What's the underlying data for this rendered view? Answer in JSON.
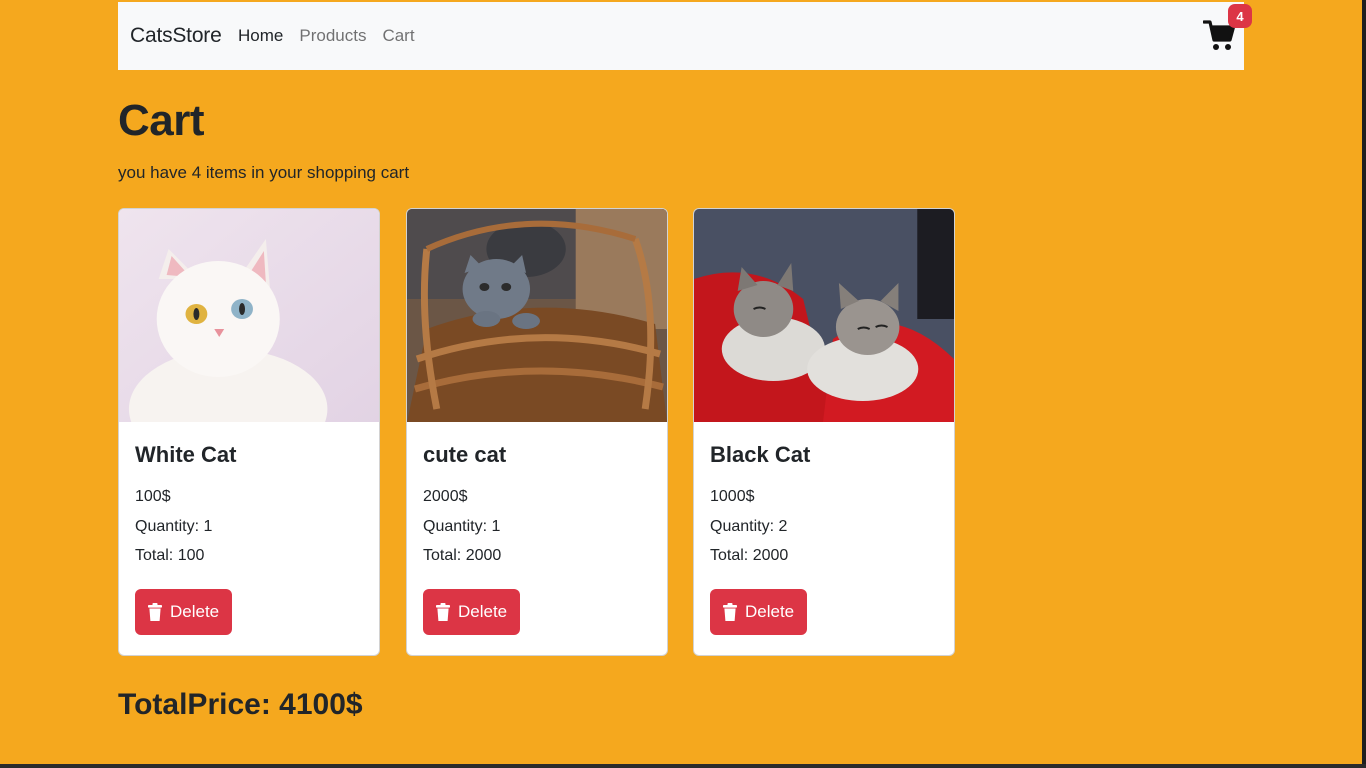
{
  "navbar": {
    "brand": "CatsStore",
    "links": [
      {
        "label": "Home",
        "active": true
      },
      {
        "label": "Products",
        "active": false
      },
      {
        "label": "Cart",
        "active": false
      }
    ],
    "cart_icon": "shopping-cart-icon",
    "cart_badge": "4"
  },
  "page": {
    "title": "Cart",
    "subtitle": "you have 4 items in your shopping cart"
  },
  "items": [
    {
      "name": "White Cat",
      "price": "100$",
      "quantity": "Quantity: 1",
      "total": "Total: 100",
      "delete_label": "Delete"
    },
    {
      "name": "cute cat",
      "price": "2000$",
      "quantity": "Quantity: 1",
      "total": "Total: 2000",
      "delete_label": "Delete"
    },
    {
      "name": "Black Cat",
      "price": "1000$",
      "quantity": "Quantity: 2",
      "total": "Total: 2000",
      "delete_label": "Delete"
    }
  ],
  "summary": {
    "total_price": "TotalPrice: 4100$"
  },
  "colors": {
    "background": "#f5a81e",
    "navbar": "#f8f9fa",
    "danger": "#dc3545"
  }
}
